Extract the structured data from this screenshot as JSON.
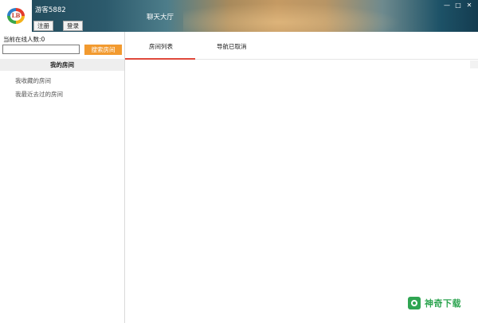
{
  "header": {
    "logo_text": "LB",
    "username": "游客5882",
    "register_label": "注册",
    "login_label": "登录",
    "hall_title": "聊天大厅",
    "window_controls": [
      "—",
      "□",
      "✕"
    ]
  },
  "sidebar": {
    "online_count": "当前在线人数:0",
    "search_placeholder": "",
    "search_button": "搜索房间",
    "my_rooms": "我的房间",
    "items": [
      {
        "label": "我收藏的房间"
      },
      {
        "label": "我最近去过的房间"
      }
    ]
  },
  "tabs": [
    {
      "label": "房间列表",
      "active": true
    },
    {
      "label": "导航已取消",
      "active": false
    }
  ],
  "watermark": {
    "text": "神奇下载",
    "icon": "shield-icon",
    "color": "#2fa552"
  },
  "colors": {
    "accent_orange": "#f29a2f",
    "tab_underline": "#e0483b"
  }
}
